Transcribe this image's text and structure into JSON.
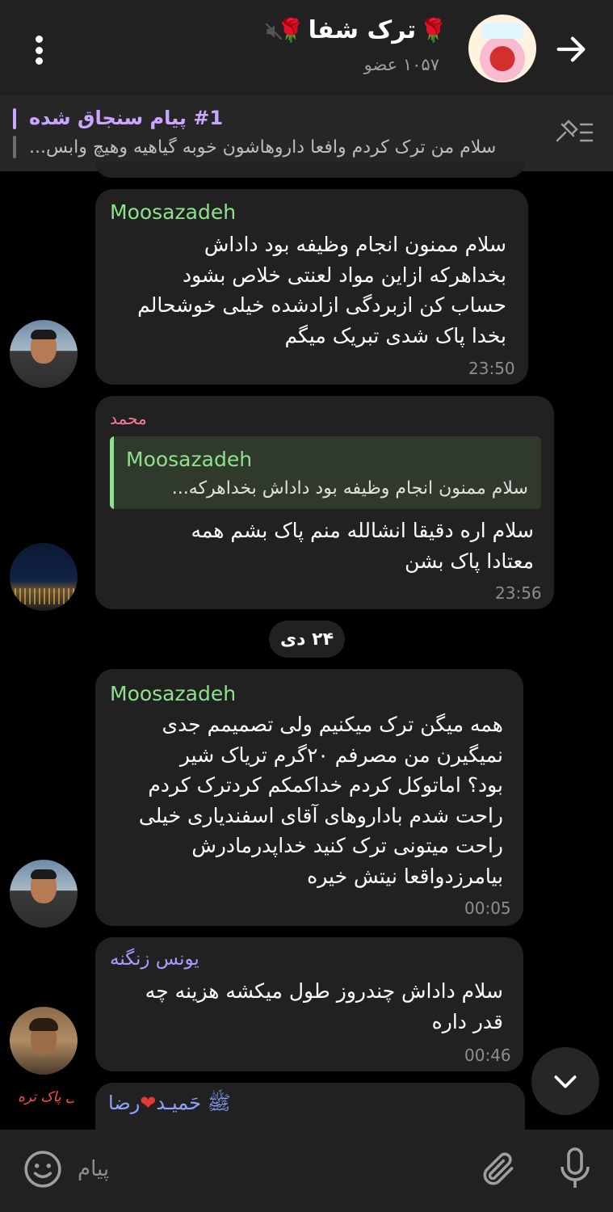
{
  "header": {
    "title": "ترک شفا",
    "rose_left": "🌹",
    "rose_right": "🌹",
    "members": "۱۰۵۷ عضو"
  },
  "pinned": {
    "title": "#1 پیام سنجاق شده",
    "text": "سلام من ترک کردم وافعا داروهاشون خوبه گیاهیه وهیچ وابس..."
  },
  "messages": [
    {
      "sender": "Moosazadeh",
      "lines": [
        "سلام ممنون انجام وظیفه بود داداش",
        "بخداهرکه ازاین مواد لعنتی خلاص بشود",
        "حساب کن ازبردگی ازادشده خیلی خوشحالم",
        "بخدا پاک شدی تبریک میگم"
      ],
      "time": "23:50"
    },
    {
      "sender": "محمد",
      "reply": {
        "name": "Moosazadeh",
        "text": "سلام ممنون انجام وظیفه بود داداش بخداهرکه..."
      },
      "lines": [
        "سلام اره دقیقا انشالله منم پاک بشم همه",
        "معتادا پاک بشن"
      ],
      "time": "23:56"
    },
    {
      "sender": "Moosazadeh",
      "lines": [
        "همه میگن ترک میکنیم ولی تصمیمم جدی",
        "نمیگیرن من مصرفم ۲۰گرم تریاک شیر",
        "بود؟ اماتوکل کردم خداکمکم کردترک کردم",
        "راحت شدم باداروهای آقای اسفندیاری خیلی",
        "راحت میتونی ترک کنید خداپدرمادرش",
        "بیامرزدواقعا نیتش خیره"
      ],
      "time": "00:05"
    },
    {
      "sender": "یونس زنگنه",
      "lines": [
        "سلام داداش چندروز طول میکشه هزینه چه",
        "قدر داره"
      ],
      "time": "00:46"
    }
  ],
  "date_separator": "۲۴ دی",
  "partial": {
    "sender_prefix": "ﷺ حَمیـد",
    "heart": "❤",
    "sender_suffix": "رضا",
    "avatar_text": "حتی پاک تره"
  },
  "input": {
    "placeholder": "پیام"
  },
  "colors": {
    "header_bg": "#212121",
    "bubble_bg": "#212121",
    "accent_green": "#8de28b",
    "accent_purple": "#c9a6ff",
    "sender_pink": "#ff7a9a",
    "sender_violet": "#a69bff"
  },
  "icons": {
    "menu": "more-vertical-icon",
    "back": "arrow-right-icon",
    "mute": "muted-speaker-icon",
    "pinned_list": "pinned-list-icon",
    "scroll": "chevron-down-icon",
    "emoji": "smiley-icon",
    "attach": "paperclip-icon",
    "mic": "microphone-icon"
  }
}
